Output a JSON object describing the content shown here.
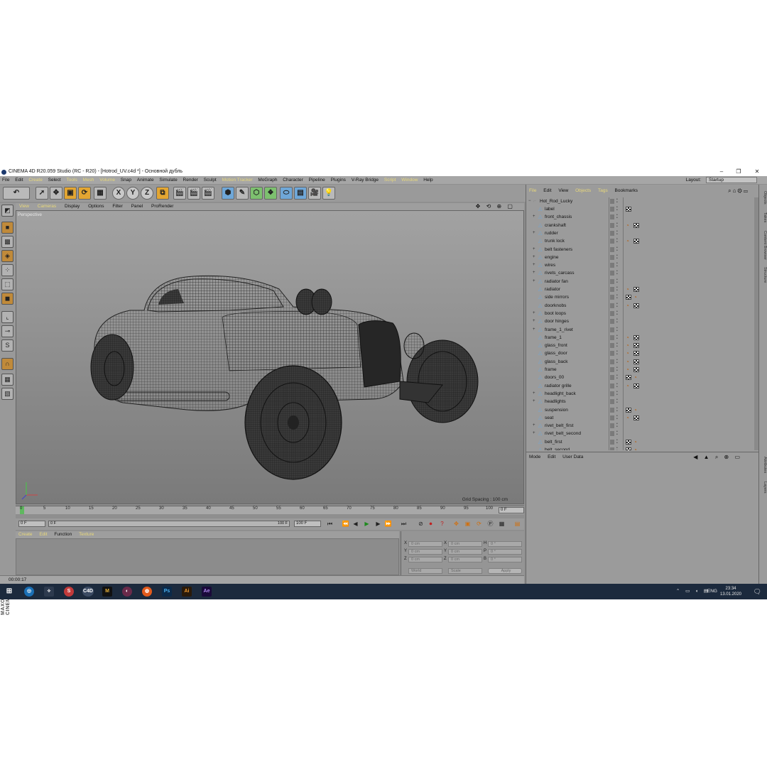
{
  "window": {
    "title": "CINEMA 4D R20.059 Studio (RC - R20) - [Hotrod_UV.c4d *] - Основной дубль",
    "minimize": "–",
    "maximize": "❐",
    "close": "✕"
  },
  "menubar": {
    "items": [
      "File",
      "Edit",
      "Create",
      "Select",
      "Tools",
      "Mesh",
      "Volume",
      "Snap",
      "Animate",
      "Simulate",
      "Render",
      "Sculpt",
      "Motion Tracker",
      "MoGraph",
      "Character",
      "Pipeline",
      "Plugins",
      "V-Ray Bridge",
      "Script",
      "Window",
      "Help"
    ],
    "layout_label": "Layout:",
    "layout_value": "Startup"
  },
  "toolbar": {
    "undo_icon": "undo-icon",
    "axis_x": "X",
    "axis_y": "Y",
    "axis_z": "Z"
  },
  "viewport": {
    "menu": [
      "View",
      "Cameras",
      "Display",
      "Options",
      "Filter",
      "Panel",
      "ProRender"
    ],
    "camera_label": "Perspective",
    "grid_spacing": "Grid Spacing : 100 cm",
    "nav_icons": "✥ ⟲ ⊕ ▢"
  },
  "timeline": {
    "ticks": [
      "0",
      "5",
      "10",
      "15",
      "20",
      "25",
      "30",
      "35",
      "40",
      "45",
      "50",
      "55",
      "60",
      "65",
      "70",
      "75",
      "80",
      "85",
      "90",
      "95",
      "100"
    ],
    "current_frame": "0 F",
    "start_field": "0 F",
    "end_field": "100 F",
    "range_start": "0 F",
    "range_end": "100 F"
  },
  "material_manager": {
    "menu": [
      "Create",
      "Edit",
      "Function",
      "Texture"
    ]
  },
  "coordinates": {
    "rows": [
      {
        "a": "X",
        "av": "0 cm",
        "b": "X",
        "bv": "0 cm",
        "c": "H",
        "cv": "0 °"
      },
      {
        "a": "Y",
        "av": "0 cm",
        "b": "Y",
        "bv": "0 cm",
        "c": "P",
        "cv": "0 °"
      },
      {
        "a": "Z",
        "av": "0 cm",
        "b": "Z",
        "bv": "0 cm",
        "c": "B",
        "cv": "0 °"
      }
    ],
    "world": "World",
    "scale": "Scale",
    "apply": "Apply"
  },
  "status": {
    "time": "00:00:17"
  },
  "object_manager": {
    "menu": [
      "File",
      "Edit",
      "View",
      "Objects",
      "Tags",
      "Bookmarks"
    ],
    "root": "Hot_Rod_Lucky",
    "objects": [
      {
        "name": "label",
        "exp": "",
        "tags": [
          "check"
        ]
      },
      {
        "name": "front_chassis",
        "exp": "+",
        "tags": []
      },
      {
        "name": "crankshaft",
        "exp": "",
        "tags": [
          "phong",
          "check"
        ]
      },
      {
        "name": "rudder",
        "exp": "+",
        "tags": []
      },
      {
        "name": "trunk lock",
        "exp": "",
        "tags": [
          "phong",
          "check"
        ]
      },
      {
        "name": "belt fasteners",
        "exp": "+",
        "tags": []
      },
      {
        "name": "engine",
        "exp": "+",
        "tags": []
      },
      {
        "name": "wires",
        "exp": "+",
        "tags": []
      },
      {
        "name": "rivets_carcass",
        "exp": "+",
        "tags": []
      },
      {
        "name": "radiator fan",
        "exp": "+",
        "tags": []
      },
      {
        "name": "radiator",
        "exp": "",
        "tags": [
          "phong",
          "check"
        ]
      },
      {
        "name": "side mirrors",
        "exp": "",
        "tags": [
          "check",
          "phong"
        ]
      },
      {
        "name": "doorknobs",
        "exp": "",
        "tags": [
          "phong",
          "check"
        ]
      },
      {
        "name": "boot loops",
        "exp": "+",
        "tags": []
      },
      {
        "name": "door hinges",
        "exp": "+",
        "tags": []
      },
      {
        "name": "frame_1_rivet",
        "exp": "+",
        "tags": []
      },
      {
        "name": "frame_1",
        "exp": "",
        "tags": [
          "phong",
          "check"
        ]
      },
      {
        "name": "glass_front",
        "exp": "",
        "tags": [
          "phong",
          "check"
        ]
      },
      {
        "name": "glass_door",
        "exp": "",
        "tags": [
          "phong",
          "check"
        ]
      },
      {
        "name": "glass_back",
        "exp": "",
        "tags": [
          "phong",
          "check"
        ]
      },
      {
        "name": "frame",
        "exp": "",
        "tags": [
          "phong",
          "check"
        ]
      },
      {
        "name": "doors_00",
        "exp": "",
        "tags": [
          "check",
          "phong"
        ]
      },
      {
        "name": "radiator grille",
        "exp": "",
        "tags": [
          "phong",
          "check"
        ]
      },
      {
        "name": "headlight_back",
        "exp": "+",
        "tags": []
      },
      {
        "name": "headlights",
        "exp": "+",
        "tags": []
      },
      {
        "name": "suspension",
        "exp": "",
        "tags": [
          "check",
          "phong"
        ]
      },
      {
        "name": "seat",
        "exp": "",
        "tags": [
          "phong",
          "check"
        ]
      },
      {
        "name": "rivet_belt_first",
        "exp": "+",
        "tags": []
      },
      {
        "name": "rivet_belt_second",
        "exp": "+",
        "tags": []
      },
      {
        "name": "belt_first",
        "exp": "",
        "tags": [
          "check",
          "phong"
        ]
      },
      {
        "name": "belt_second",
        "exp": "",
        "tags": [
          "check",
          "phong"
        ]
      }
    ]
  },
  "attribute_manager": {
    "menu": [
      "Mode",
      "Edit",
      "User Data"
    ]
  },
  "right_tabs": [
    "Objects",
    "Takes",
    "Content Browser",
    "Structure",
    "Attributes",
    "Layers"
  ],
  "taskbar": {
    "apps": [
      "C4D",
      "M",
      "Ps",
      "Ai",
      "Ae"
    ],
    "lang": "ENG",
    "time": "23:34",
    "date": "13.01.2020"
  },
  "colors": {
    "accent_menu": "#e8d87a",
    "panel_bg": "#9b9b9b",
    "taskbar": "#1c2a3d"
  }
}
